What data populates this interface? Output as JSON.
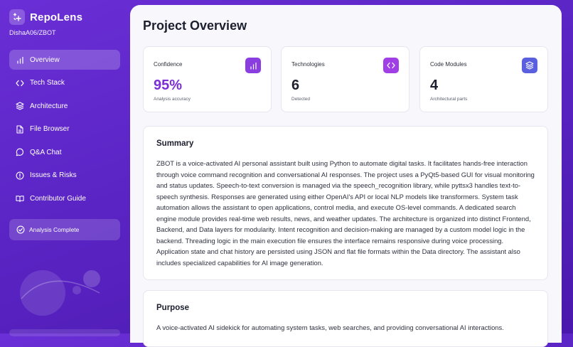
{
  "brand": {
    "name": "RepoLens",
    "repo": "DishaA06/ZBOT"
  },
  "nav": [
    {
      "label": "Overview",
      "icon": "bar-chart-icon",
      "active": true
    },
    {
      "label": "Tech Stack",
      "icon": "code-icon"
    },
    {
      "label": "Architecture",
      "icon": "layers-icon"
    },
    {
      "label": "File Browser",
      "icon": "file-icon"
    },
    {
      "label": "Q&A Chat",
      "icon": "chat-bubble-icon"
    },
    {
      "label": "Issues & Risks",
      "icon": "alert-circle-icon"
    },
    {
      "label": "Contributor Guide",
      "icon": "book-icon"
    }
  ],
  "status": {
    "label": "Analysis Complete",
    "icon": "check-circle-icon"
  },
  "page": {
    "title": "Project Overview"
  },
  "stats": [
    {
      "label": "Confidence",
      "value": "95%",
      "sub": "Analysis accuracy",
      "icon": "bar-chart-icon",
      "accent": "#8a3ee0"
    },
    {
      "label": "Technologies",
      "value": "6",
      "sub": "Detected",
      "icon": "code-icon",
      "accent": "#a13fe6"
    },
    {
      "label": "Code Modules",
      "value": "4",
      "sub": "Architectural parts",
      "icon": "layers-icon",
      "accent": "#5a5fe0"
    }
  ],
  "summary": {
    "title": "Summary",
    "body": "ZBOT is a voice-activated AI personal assistant built using Python to automate digital tasks. It facilitates hands-free interaction through voice command recognition and conversational AI responses. The project uses a PyQt5-based GUI for visual monitoring and status updates. Speech-to-text conversion is managed via the speech_recognition library, while pyttsx3 handles text-to-speech synthesis. Responses are generated using either OpenAI's API or local NLP models like transformers. System task automation allows the assistant to open applications, control media, and execute OS-level commands. A dedicated search engine module provides real-time web results, news, and weather updates. The architecture is organized into distinct Frontend, Backend, and Data layers for modularity. Intent recognition and decision-making are managed by a custom model logic in the backend. Threading logic in the main execution file ensures the interface remains responsive during voice processing. Application state and chat history are persisted using JSON and flat file formats within the Data directory. The assistant also includes specialized capabilities for AI image generation."
  },
  "purpose": {
    "title": "Purpose",
    "body": "A voice-activated AI sidekick for automating system tasks, web searches, and providing conversational AI interactions."
  },
  "colors": {
    "accent": "#8a3ee0",
    "sidebar": "#5a24c4"
  }
}
